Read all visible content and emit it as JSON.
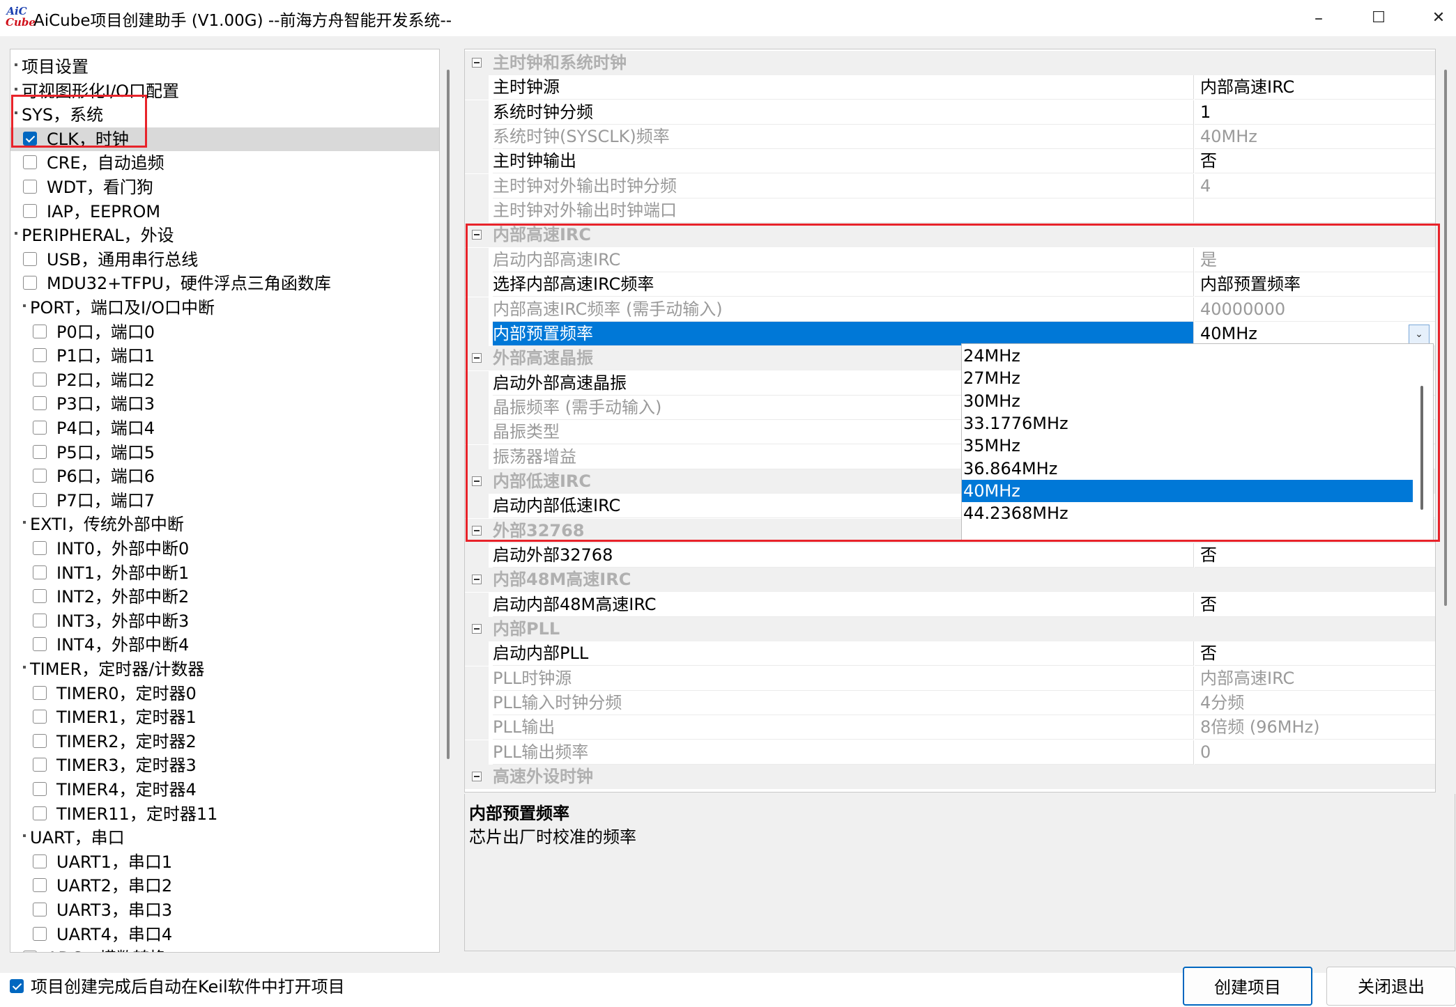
{
  "window": {
    "title": "AiCube项目创建助手 (V1.00G) --前海方舟智能开发系统--",
    "logo_top": "AiC",
    "logo_bottom": "Cube",
    "minimize": "–",
    "maximize": "☐",
    "close": "✕"
  },
  "tree": {
    "items": [
      {
        "label": "项目设置"
      },
      {
        "label": "可视图形化I/O口配置"
      },
      {
        "label": "SYS，系统"
      },
      {
        "label": "CLK，时钟"
      },
      {
        "label": "CRE，自动追频"
      },
      {
        "label": "WDT，看门狗"
      },
      {
        "label": "IAP，EEPROM"
      },
      {
        "label": "PERIPHERAL，外设"
      },
      {
        "label": "USB，通用串行总线"
      },
      {
        "label": "MDU32+TFPU，硬件浮点三角函数库"
      },
      {
        "label": "PORT，端口及I/O口中断"
      },
      {
        "label": "P0口，端口0"
      },
      {
        "label": "P1口，端口1"
      },
      {
        "label": "P2口，端口2"
      },
      {
        "label": "P3口，端口3"
      },
      {
        "label": "P4口，端口4"
      },
      {
        "label": "P5口，端口5"
      },
      {
        "label": "P6口，端口6"
      },
      {
        "label": "P7口，端口7"
      },
      {
        "label": "EXTI，传统外部中断"
      },
      {
        "label": "INT0，外部中断0"
      },
      {
        "label": "INT1，外部中断1"
      },
      {
        "label": "INT2，外部中断2"
      },
      {
        "label": "INT3，外部中断3"
      },
      {
        "label": "INT4，外部中断4"
      },
      {
        "label": "TIMER，定时器/计数器"
      },
      {
        "label": "TIMER0，定时器0"
      },
      {
        "label": "TIMER1，定时器1"
      },
      {
        "label": "TIMER2，定时器2"
      },
      {
        "label": "TIMER3，定时器3"
      },
      {
        "label": "TIMER4，定时器4"
      },
      {
        "label": "TIMER11，定时器11"
      },
      {
        "label": "UART，串口"
      },
      {
        "label": "UART1，串口1"
      },
      {
        "label": "UART2，串口2"
      },
      {
        "label": "UART3，串口3"
      },
      {
        "label": "UART4，串口4"
      },
      {
        "label": "ADC，模数转换"
      }
    ]
  },
  "grid": {
    "rows": [
      {
        "kind": "cat",
        "label": "主时钟和系统时钟"
      },
      {
        "kind": "prop",
        "name": "主时钟源",
        "value": "内部高速IRC"
      },
      {
        "kind": "prop",
        "name": "系统时钟分频",
        "value": "1"
      },
      {
        "kind": "prop",
        "name": "系统时钟(SYSCLK)频率",
        "value": "40MHz"
      },
      {
        "kind": "prop",
        "name": "主时钟输出",
        "value": "否"
      },
      {
        "kind": "prop",
        "name": "主时钟对外输出时钟分频",
        "value": "4"
      },
      {
        "kind": "prop",
        "name": "主时钟对外输出时钟端口",
        "value": ""
      },
      {
        "kind": "cat",
        "label": "内部高速IRC"
      },
      {
        "kind": "prop",
        "name": "启动内部高速IRC",
        "value": "是"
      },
      {
        "kind": "prop",
        "name": "选择内部高速IRC频率",
        "value": "内部预置频率"
      },
      {
        "kind": "prop",
        "name": "内部高速IRC频率 (需手动输入)",
        "value": "40000000"
      },
      {
        "kind": "prop",
        "name": "内部预置频率",
        "value": "40MHz"
      },
      {
        "kind": "cat",
        "label": "外部高速晶振"
      },
      {
        "kind": "prop",
        "name": "启动外部高速晶振",
        "value": ""
      },
      {
        "kind": "prop",
        "name": "晶振频率 (需手动输入)",
        "value": ""
      },
      {
        "kind": "prop",
        "name": "晶振类型",
        "value": ""
      },
      {
        "kind": "prop",
        "name": "振荡器增益",
        "value": ""
      },
      {
        "kind": "cat",
        "label": "内部低速IRC"
      },
      {
        "kind": "prop",
        "name": "启动内部低速IRC",
        "value": ""
      },
      {
        "kind": "cat",
        "label": "外部32768"
      },
      {
        "kind": "prop",
        "name": "启动外部32768",
        "value": "否"
      },
      {
        "kind": "cat",
        "label": "内部48M高速IRC"
      },
      {
        "kind": "prop",
        "name": "启动内部48M高速IRC",
        "value": "否"
      },
      {
        "kind": "cat",
        "label": "内部PLL"
      },
      {
        "kind": "prop",
        "name": "启动内部PLL",
        "value": "否"
      },
      {
        "kind": "prop",
        "name": "PLL时钟源",
        "value": "内部高速IRC"
      },
      {
        "kind": "prop",
        "name": "PLL输入时钟分频",
        "value": "4分频"
      },
      {
        "kind": "prop",
        "name": "PLL输出",
        "value": "8倍频 (96MHz)"
      },
      {
        "kind": "prop",
        "name": "PLL输出频率",
        "value": "0"
      },
      {
        "kind": "cat",
        "label": "高速外设时钟"
      }
    ],
    "combo_arrow": "⌄",
    "dropdown": {
      "options": [
        "24MHz",
        "27MHz",
        "30MHz",
        "33.1776MHz",
        "35MHz",
        "36.864MHz",
        "40MHz",
        "44.2368MHz"
      ],
      "selected": "40MHz"
    }
  },
  "description": {
    "title": "内部预置频率",
    "text": "芯片出厂时校准的频率"
  },
  "footer": {
    "auto_open_label": "项目创建完成后自动在Keil软件中打开项目",
    "auto_open_checked": true,
    "create_button": "创建项目",
    "close_button": "关闭退出"
  },
  "colors": {
    "selection": "#0078d7",
    "highlight_box": "#e8232a",
    "checkbox": "#0067c0"
  }
}
